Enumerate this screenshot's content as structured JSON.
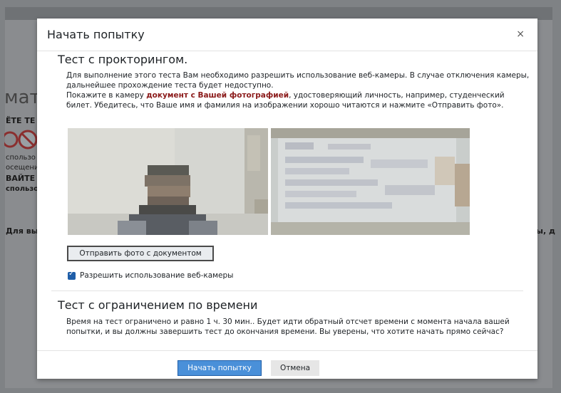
{
  "background": {
    "heading": "мати",
    "line1": "ЁТЕ ТЕ",
    "line2": "спользо",
    "line3": "осещени",
    "line4": "ВАЙТЕ",
    "line5": "спользо",
    "line6": "Для вы",
    "line7": "ы, д"
  },
  "modal": {
    "title": "Начать попытку",
    "close_glyph": "×"
  },
  "proctoring": {
    "title": "Тест с прокторингом.",
    "para1": "Для выполнение этого теста Вам необходимо разрешить использование веб-камеры. В случае отключения камеры, дальнейшее прохождение теста будет недоступно.",
    "para2_before": "Покажите в камеру ",
    "para2_highlight": "документ с Вашей фотографией",
    "para2_after": ", удостоверяющий личность, например, студенческий билет. Убедитесь, что Ваше имя и фамилия на изображении хорошо читаются и нажмите «Отправить фото».",
    "send_button": "Отправить фото с документом",
    "webcam_checkbox_label": "Разрешить использование веб-камеры",
    "webcam_checked": true
  },
  "time_limit": {
    "title": "Тест с ограничением по времени",
    "text": "Время на тест ограничено и равно 1 ч. 30 мин.. Будет идти обратный отсчет времени с момента начала вашей попытки, и вы должны завершить тест до окончания времени. Вы уверены, что хотите начать прямо сейчас?"
  },
  "footer": {
    "start_button": "Начать попытку",
    "cancel_button": "Отмена"
  },
  "colors": {
    "primary": "#4a90d9",
    "highlight": "#8b1a1a",
    "overlay": "#7f8285"
  }
}
